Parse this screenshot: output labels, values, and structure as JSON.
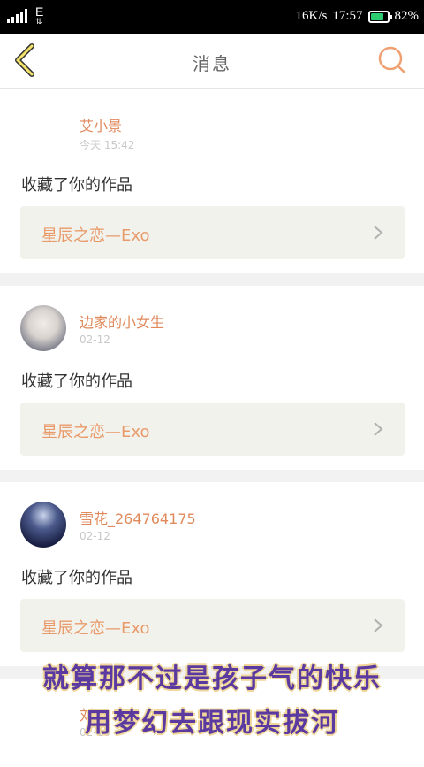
{
  "status_bar": {
    "signal_label": "1",
    "network": "E",
    "speed": "16K/s",
    "time": "17:57",
    "battery": "82%",
    "battery_level": 0.82,
    "battery_color": "#2ecc71"
  },
  "header": {
    "back_icon": "chevron-left-icon",
    "title": "消息",
    "search_icon": "search-icon",
    "accent": "#f0a070"
  },
  "messages": [
    {
      "user_name": "艾小景",
      "time": "今天 15:42",
      "action": "收藏了你的作品",
      "work_title": "星辰之恋—Exo"
    },
    {
      "user_name": "边家的小女生",
      "time": "02-12",
      "action": "收藏了你的作品",
      "work_title": "星辰之恋—Exo"
    },
    {
      "user_name": "雪花_264764175",
      "time": "02-12",
      "action": "收藏了你的作品",
      "work_title": "星辰之恋—Exo"
    },
    {
      "user_name": "刘",
      "time": "02-10"
    }
  ],
  "overlay": {
    "line1": "就算那不过是孩子气的快乐",
    "line2": "用梦幻去跟现实拔河"
  }
}
